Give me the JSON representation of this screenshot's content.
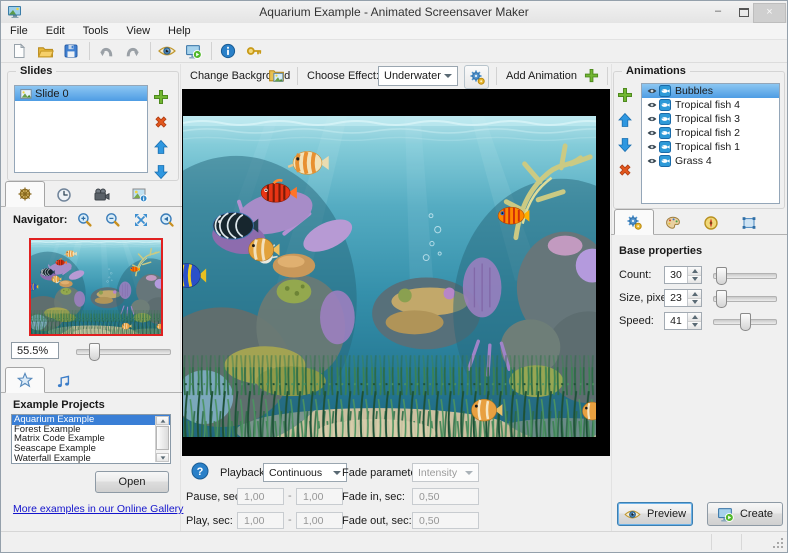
{
  "window": {
    "title": "Aquarium Example - Animated Screensaver Maker",
    "minimize_glyph": "–",
    "close_glyph": "×"
  },
  "menubar": {
    "items": [
      {
        "label": "File"
      },
      {
        "label": "Edit"
      },
      {
        "label": "Tools"
      },
      {
        "label": "View"
      },
      {
        "label": "Help"
      }
    ]
  },
  "toolbar": {
    "icons": [
      "new-document",
      "open-project",
      "save-project",
      "undo",
      "redo",
      "preview-eye",
      "create-screensaver",
      "info",
      "license-key"
    ]
  },
  "slides": {
    "title": "Slides",
    "items": [
      {
        "label": "Slide 0",
        "selected": true
      }
    ],
    "buttons": [
      "add-slide",
      "delete-slide",
      "move-slide-up",
      "move-slide-down"
    ]
  },
  "left_tabs": {
    "icons": [
      "ship-wheel",
      "clock",
      "video-camera",
      "image-export"
    ]
  },
  "navigator": {
    "label": "Navigator:",
    "zoom_value": "55.5%",
    "tools": [
      "zoom-in",
      "zoom-out",
      "fit-to-window",
      "actual-size"
    ]
  },
  "projects": {
    "title": "Example Projects",
    "items": [
      {
        "label": "Aquarium Example",
        "selected": true
      },
      {
        "label": "Forest Example"
      },
      {
        "label": "Matrix Code Example"
      },
      {
        "label": "Seascape Example"
      },
      {
        "label": "Waterfall Example"
      }
    ],
    "open_button": "Open",
    "gallery_link": "More examples in our Online Gallery",
    "tabs": [
      "example-projects-star",
      "music"
    ]
  },
  "canvas_bar": {
    "change_background": "Change Background",
    "choose_effect": "Choose Effect:",
    "effect_value": "Underwater",
    "add_animation": "Add Animation"
  },
  "animations": {
    "title": "Animations",
    "items": [
      {
        "label": "Bubbles",
        "selected": true
      },
      {
        "label": "Tropical fish 4"
      },
      {
        "label": "Tropical fish 3"
      },
      {
        "label": "Tropical fish 2"
      },
      {
        "label": "Tropical fish 1"
      },
      {
        "label": "Grass 4"
      }
    ],
    "buttons": [
      "add-animation",
      "move-animation-up",
      "move-animation-down",
      "delete-animation"
    ],
    "tabs": [
      "base-properties-gear",
      "appearance-palette",
      "movement-compass",
      "placement-area"
    ]
  },
  "properties": {
    "title": "Base properties",
    "count_label": "Count:",
    "count_value": "30",
    "size_label": "Size, pixels:",
    "size_value": "23",
    "speed_label": "Speed:",
    "speed_value": "41"
  },
  "playback": {
    "playback_label": "Playback:",
    "playback_value": "Continuous",
    "fade_param_label": "Fade parameter:",
    "fade_param_value": "Intensity",
    "pause_label": "Pause, sec:",
    "pause_from": "1,00",
    "pause_to": "1,00",
    "play_label": "Play, sec:",
    "play_from": "1,00",
    "play_to": "1,00",
    "fade_in_label": "Fade in, sec:",
    "fade_in_value": "0,50",
    "fade_out_label": "Fade out, sec:",
    "fade_out_value": "0,50",
    "range_dash": "-"
  },
  "actions": {
    "preview": "Preview",
    "create": "Create"
  },
  "colors": {
    "selection_blue": "#4e9ce4",
    "project_selection": "#3a7fd6",
    "link_blue": "#1414cc",
    "accent_green": "#72b632",
    "accent_orange": "#e2571e",
    "arrow_blue": "#2e97e0",
    "thumbnail_border_red": "#e02020"
  }
}
